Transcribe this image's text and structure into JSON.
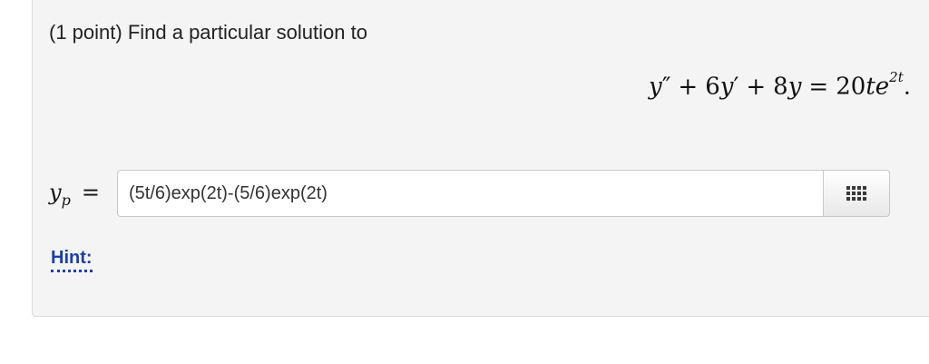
{
  "problem": {
    "statement": "(1 point) Find a particular solution to",
    "equation": {
      "y1": "y",
      "prime2": "″",
      "plus1": "+",
      "coef6": "6",
      "y2": "y",
      "prime1": "′",
      "plus2": "+",
      "coef8": "8",
      "y3": "y",
      "equals": "=",
      "coef20": "20",
      "t": "t",
      "e": "e",
      "exponent": "2t",
      "period": "."
    }
  },
  "answer": {
    "label_var": "y",
    "label_sub": "p",
    "label_eq": "=",
    "value": "(5t/6)exp(2t)-(5/6)exp(2t)"
  },
  "toolbar": {
    "matrix_icon": "grid-icon"
  },
  "hint": {
    "label": "Hint:"
  }
}
